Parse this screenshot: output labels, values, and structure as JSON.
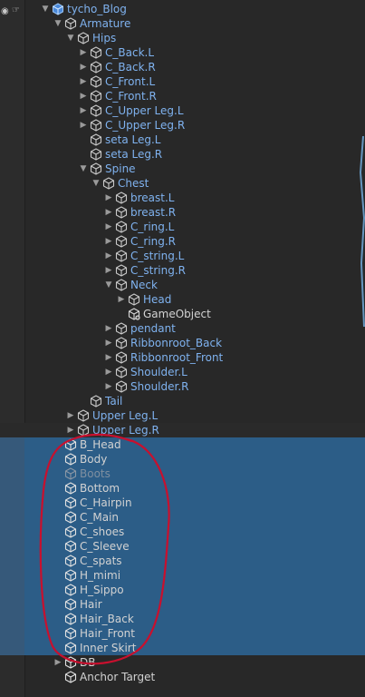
{
  "colors": {
    "selection": "#2c5d87",
    "prefab_text": "#7fb2ef",
    "plain_text": "#d2d2d2",
    "annotation": "#c8102e"
  },
  "tree": [
    {
      "label": "tycho_Blog",
      "depth": 0,
      "arrow": "down",
      "type": "prefab-root",
      "text": "blue"
    },
    {
      "label": "Armature",
      "depth": 1,
      "arrow": "down",
      "type": "prefab",
      "text": "blue"
    },
    {
      "label": "Hips",
      "depth": 2,
      "arrow": "down",
      "type": "prefab",
      "text": "blue"
    },
    {
      "label": "C_Back.L",
      "depth": 3,
      "arrow": "right",
      "type": "prefab",
      "text": "blue"
    },
    {
      "label": "C_Back.R",
      "depth": 3,
      "arrow": "right",
      "type": "prefab",
      "text": "blue"
    },
    {
      "label": "C_Front.L",
      "depth": 3,
      "arrow": "right",
      "type": "prefab",
      "text": "blue"
    },
    {
      "label": "C_Front.R",
      "depth": 3,
      "arrow": "right",
      "type": "prefab",
      "text": "blue"
    },
    {
      "label": "C_Upper Leg.L",
      "depth": 3,
      "arrow": "right",
      "type": "prefab",
      "text": "blue"
    },
    {
      "label": "C_Upper Leg.R",
      "depth": 3,
      "arrow": "right",
      "type": "prefab",
      "text": "blue"
    },
    {
      "label": "seta Leg.L",
      "depth": 3,
      "arrow": "none",
      "type": "prefab",
      "text": "blue"
    },
    {
      "label": "seta Leg.R",
      "depth": 3,
      "arrow": "none",
      "type": "prefab",
      "text": "blue"
    },
    {
      "label": "Spine",
      "depth": 3,
      "arrow": "down",
      "type": "prefab",
      "text": "blue"
    },
    {
      "label": "Chest",
      "depth": 4,
      "arrow": "down",
      "type": "prefab",
      "text": "blue"
    },
    {
      "label": "breast.L",
      "depth": 5,
      "arrow": "right",
      "type": "prefab",
      "text": "blue"
    },
    {
      "label": "breast.R",
      "depth": 5,
      "arrow": "right",
      "type": "prefab",
      "text": "blue"
    },
    {
      "label": "C_ring.L",
      "depth": 5,
      "arrow": "right",
      "type": "prefab",
      "text": "blue"
    },
    {
      "label": "C_ring.R",
      "depth": 5,
      "arrow": "right",
      "type": "prefab",
      "text": "blue"
    },
    {
      "label": "C_string.L",
      "depth": 5,
      "arrow": "right",
      "type": "prefab",
      "text": "blue"
    },
    {
      "label": "C_string.R",
      "depth": 5,
      "arrow": "right",
      "type": "prefab",
      "text": "blue"
    },
    {
      "label": "Neck",
      "depth": 5,
      "arrow": "down",
      "type": "prefab",
      "text": "blue"
    },
    {
      "label": "Head",
      "depth": 6,
      "arrow": "right",
      "type": "prefab",
      "text": "blue"
    },
    {
      "label": "GameObject",
      "depth": 6,
      "arrow": "none",
      "type": "added",
      "text": "white"
    },
    {
      "label": "pendant",
      "depth": 5,
      "arrow": "right",
      "type": "prefab",
      "text": "blue"
    },
    {
      "label": "Ribbonroot_Back",
      "depth": 5,
      "arrow": "right",
      "type": "prefab",
      "text": "blue"
    },
    {
      "label": "Ribbonroot_Front",
      "depth": 5,
      "arrow": "right",
      "type": "prefab",
      "text": "blue"
    },
    {
      "label": "Shoulder.L",
      "depth": 5,
      "arrow": "right",
      "type": "prefab",
      "text": "blue"
    },
    {
      "label": "Shoulder.R",
      "depth": 5,
      "arrow": "right",
      "type": "prefab",
      "text": "blue"
    },
    {
      "label": "Tail",
      "depth": 3,
      "arrow": "none",
      "type": "prefab",
      "text": "blue"
    },
    {
      "label": "Upper Leg.L",
      "depth": 2,
      "arrow": "right",
      "type": "prefab",
      "text": "blue"
    },
    {
      "label": "Upper Leg.R",
      "depth": 2,
      "arrow": "right",
      "type": "prefab",
      "text": "blue",
      "hover": true
    },
    {
      "label": "B_Head",
      "depth": 1,
      "arrow": "none",
      "type": "plain",
      "text": "white",
      "selected": true
    },
    {
      "label": "Body",
      "depth": 1,
      "arrow": "none",
      "type": "plain",
      "text": "white",
      "selected": true
    },
    {
      "label": "Boots",
      "depth": 1,
      "arrow": "none",
      "type": "plain-dim",
      "text": "dim",
      "selected": true
    },
    {
      "label": "Bottom",
      "depth": 1,
      "arrow": "none",
      "type": "plain",
      "text": "white",
      "selected": true
    },
    {
      "label": "C_Hairpin",
      "depth": 1,
      "arrow": "none",
      "type": "plain",
      "text": "white",
      "selected": true
    },
    {
      "label": "C_Main",
      "depth": 1,
      "arrow": "none",
      "type": "plain",
      "text": "white",
      "selected": true
    },
    {
      "label": "C_shoes",
      "depth": 1,
      "arrow": "none",
      "type": "plain",
      "text": "white",
      "selected": true
    },
    {
      "label": "C_Sleeve",
      "depth": 1,
      "arrow": "none",
      "type": "plain",
      "text": "white",
      "selected": true
    },
    {
      "label": "C_spats",
      "depth": 1,
      "arrow": "none",
      "type": "plain",
      "text": "white",
      "selected": true
    },
    {
      "label": "H_mimi",
      "depth": 1,
      "arrow": "none",
      "type": "plain",
      "text": "white",
      "selected": true
    },
    {
      "label": "H_Sippo",
      "depth": 1,
      "arrow": "none",
      "type": "plain",
      "text": "white",
      "selected": true
    },
    {
      "label": "Hair",
      "depth": 1,
      "arrow": "none",
      "type": "plain",
      "text": "white",
      "selected": true
    },
    {
      "label": "Hair_Back",
      "depth": 1,
      "arrow": "none",
      "type": "plain",
      "text": "white",
      "selected": true
    },
    {
      "label": "Hair_Front",
      "depth": 1,
      "arrow": "none",
      "type": "plain",
      "text": "white",
      "selected": true
    },
    {
      "label": "Inner Skirt",
      "depth": 1,
      "arrow": "none",
      "type": "plain",
      "text": "white",
      "selected": true
    },
    {
      "label": "DB",
      "depth": 1,
      "arrow": "right",
      "type": "plain",
      "text": "white"
    },
    {
      "label": "Anchor Target",
      "depth": 1,
      "arrow": "none",
      "type": "plain",
      "text": "white"
    }
  ],
  "icons": {
    "visibility": "eye-icon",
    "pickable": "hand-pointer-icon",
    "expand": "chevron-down-icon",
    "collapse": "chevron-right-icon",
    "gameobject": "cube-icon"
  }
}
